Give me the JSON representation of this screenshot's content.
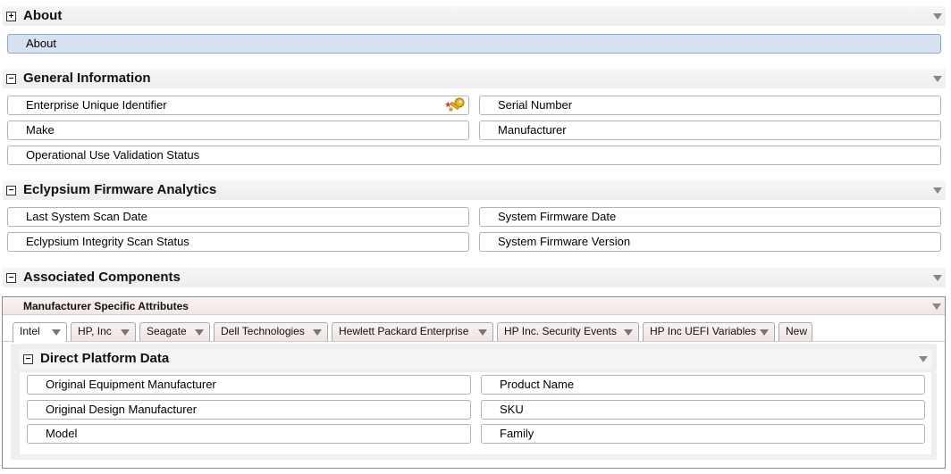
{
  "sections": {
    "about": {
      "title": "About",
      "toggle": "+",
      "fields": {
        "about": "About"
      }
    },
    "general": {
      "title": "General Information",
      "toggle": "−",
      "fields": {
        "eui": "Enterprise Unique Identifier",
        "serial": "Serial Number",
        "make": "Make",
        "manufacturer": "Manufacturer",
        "ouvs": "Operational Use Validation Status"
      },
      "required_marker": "*"
    },
    "eclypsium": {
      "title": "Eclypsium Firmware Analytics",
      "toggle": "−",
      "fields": {
        "last_scan": "Last System Scan Date",
        "fw_date": "System Firmware Date",
        "integrity": "Eclypsium Integrity Scan Status",
        "fw_version": "System Firmware Version"
      }
    },
    "associated": {
      "title": "Associated Components",
      "toggle": "−"
    }
  },
  "msa": {
    "title": "Manufacturer Specific Attributes",
    "tabs": [
      {
        "label": "Intel"
      },
      {
        "label": "HP, Inc"
      },
      {
        "label": "Seagate"
      },
      {
        "label": "Dell Technologies"
      },
      {
        "label": "Hewlett Packard Enterprise"
      },
      {
        "label": "HP Inc. Security Events"
      },
      {
        "label": "HP Inc UEFI Variables"
      },
      {
        "label": "New"
      }
    ],
    "active_tab": "Intel",
    "dpd": {
      "title": "Direct Platform Data",
      "toggle": "−",
      "fields": {
        "oem": "Original Equipment Manufacturer",
        "product_name": "Product Name",
        "odm": "Original Design Manufacturer",
        "sku": "SKU",
        "model": "Model",
        "family": "Family"
      }
    }
  },
  "colors": {
    "selected_field_bg": "#d7e2f1",
    "required_marker": "#e02020",
    "key_icon": "#e0a81c"
  },
  "icons": {
    "expand": "plus-square-icon",
    "collapse": "minus-square-icon",
    "caret": "triangle-down-icon",
    "key": "key-icon",
    "required": "asterisk-icon"
  }
}
